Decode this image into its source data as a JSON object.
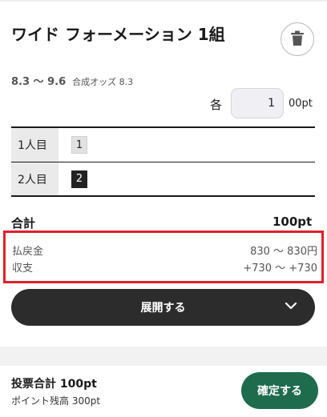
{
  "bet": {
    "title": "ワイド フォーメーション 1組",
    "odds_range": "8.3 〜 9.6",
    "odds_label": "合成オッズ 8.3",
    "each_label": "各",
    "amount_value": "1",
    "amount_unit": "00pt"
  },
  "horses": [
    {
      "label": "1人目",
      "number": "1",
      "style": "light"
    },
    {
      "label": "2人目",
      "number": "2",
      "style": "dark"
    }
  ],
  "total": {
    "label": "合計",
    "value": "100pt"
  },
  "payout": {
    "refund_label": "払戻金",
    "refund_value": "830 〜 830円",
    "balance_label": "収支",
    "balance_value": "+730 〜 +730"
  },
  "expand": {
    "label": "展開する"
  },
  "footer": {
    "vote_total": "投票合計 100pt",
    "point_balance": "ポイント残高 300pt",
    "confirm_label": "確定する"
  },
  "colors": {
    "confirm": "#1f6b4e",
    "highlight_border": "#e0202a",
    "expand_bg": "#2c2c2c"
  },
  "icons": {
    "delete": "trash-icon",
    "expand": "chevron-down-icon"
  }
}
